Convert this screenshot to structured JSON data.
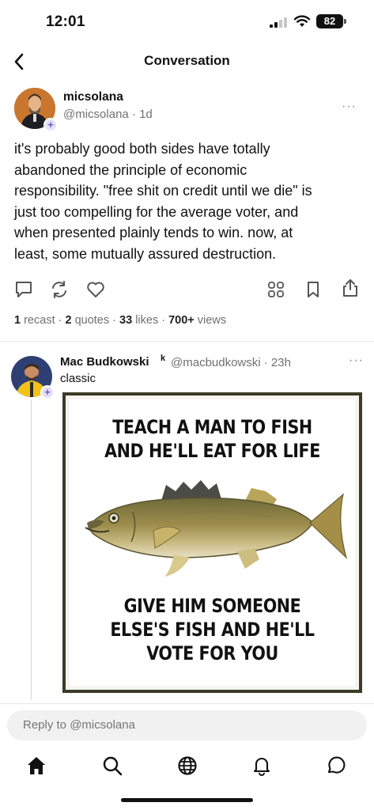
{
  "status_bar": {
    "time": "12:01",
    "battery": "82"
  },
  "header": {
    "title": "Conversation"
  },
  "post": {
    "author_name": "micsolana",
    "handle_time": "@micsolana · 1d",
    "body_lines": [
      "it's probably good both sides have totally",
      "abandoned the principle of economic",
      "responsibility. \"free shit on credit until we die\" is",
      "just too compelling for the average voter, and",
      "when presented plainly tends to win. now, at",
      "least, some mutually assured destruction."
    ],
    "stats": {
      "recasts_count": "1",
      "recasts_label": " recast",
      "sep": " · ",
      "quotes_count": "2",
      "quotes_label": " quotes",
      "likes_count": "33",
      "likes_label": " likes",
      "views_count": "700+",
      "views_label": " views"
    }
  },
  "reply": {
    "author_name": "Mac Budkowski",
    "badge": "k",
    "handle_time": "@macbudkowski · 23h",
    "text": "classic",
    "meme": {
      "top_lines": [
        "TEACH A MAN TO FISH",
        "AND HE'LL EAT FOR LIFE"
      ],
      "bottom_lines": [
        "GIVE HIM SOMEONE",
        "ELSE'S FISH AND HE'LL",
        "VOTE FOR YOU"
      ]
    }
  },
  "composer": {
    "placeholder": "Reply to @micsolana"
  },
  "more_label": "···",
  "plus": "+",
  "icons": [
    "back-chevron-icon",
    "comment-icon",
    "recast-icon",
    "heart-icon",
    "grid-icon",
    "bookmark-icon",
    "share-icon",
    "home-icon",
    "search-icon",
    "globe-icon",
    "bell-icon",
    "chat-icon"
  ]
}
